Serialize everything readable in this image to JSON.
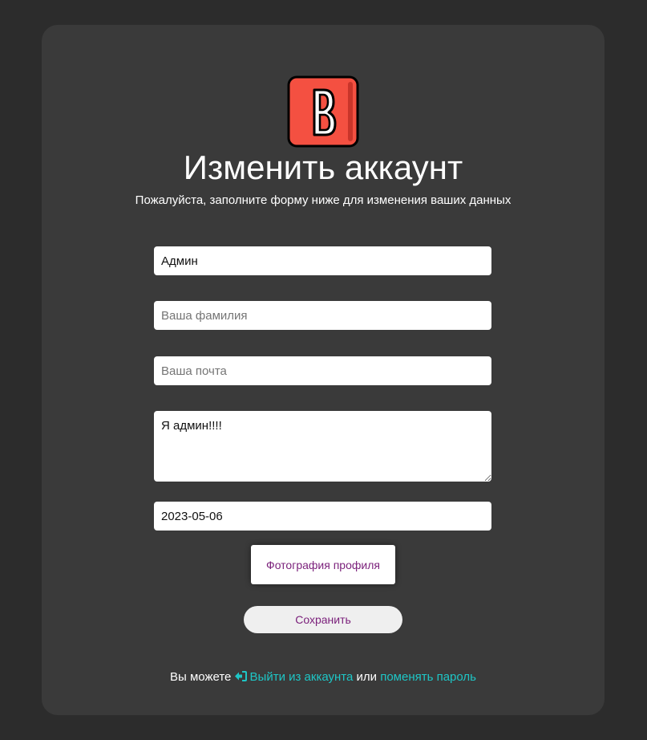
{
  "header": {
    "title": "Изменить аккаунт",
    "subtitle": "Пожалуйста, заполните форму ниже для изменения ваших данных",
    "logo_letter": "B",
    "logo_color": "#f45041"
  },
  "form": {
    "first_name": {
      "value": "Админ",
      "placeholder": ""
    },
    "last_name": {
      "value": "",
      "placeholder": "Ваша фамилия"
    },
    "email": {
      "value": "",
      "placeholder": "Ваша почта"
    },
    "about": {
      "value": "Я админ!!!!"
    },
    "birth_date": {
      "value": "2023-05-06"
    },
    "photo_label": "Фотография профиля",
    "save_label": "Сохранить"
  },
  "footer": {
    "prefix": "Вы можете",
    "logout_icon": "logout-icon",
    "logout_link": "Выйти из аккаунта",
    "conjunction": "или",
    "change_password_link": "поменять пароль"
  },
  "colors": {
    "page_background": "#2c2c2c",
    "card_background": "#3a3a3a",
    "link": "#1ec6c6",
    "button_text": "#7a1f7a"
  }
}
